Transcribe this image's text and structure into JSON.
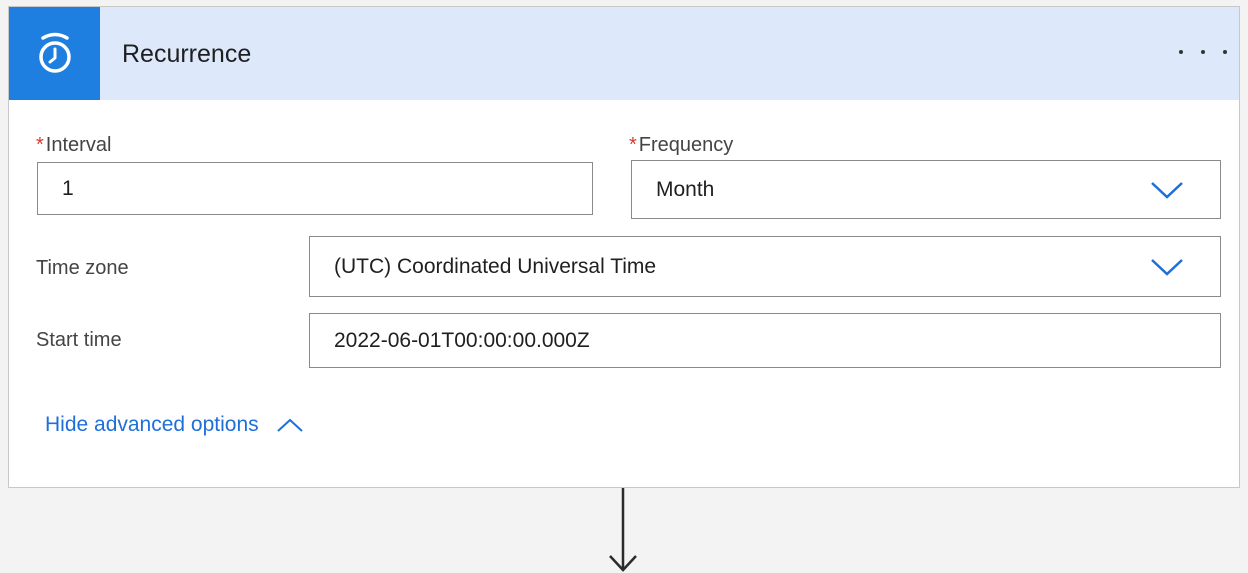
{
  "header": {
    "title": "Recurrence",
    "icon": "alarm-clock-icon",
    "accent_color": "#1f7fe0",
    "header_bg": "#dde9fb"
  },
  "fields": {
    "interval": {
      "required": "*",
      "label": "Interval",
      "value": "1"
    },
    "frequency": {
      "required": "*",
      "label": "Frequency",
      "value": "Month"
    },
    "time_zone": {
      "label": "Time zone",
      "value": "(UTC) Coordinated Universal Time"
    },
    "start_time": {
      "label": "Start time",
      "value": "2022-06-01T00:00:00.000Z"
    }
  },
  "advanced": {
    "label": "Hide advanced options"
  },
  "colors": {
    "link": "#1e6fd9",
    "required": "#d33a2f"
  }
}
